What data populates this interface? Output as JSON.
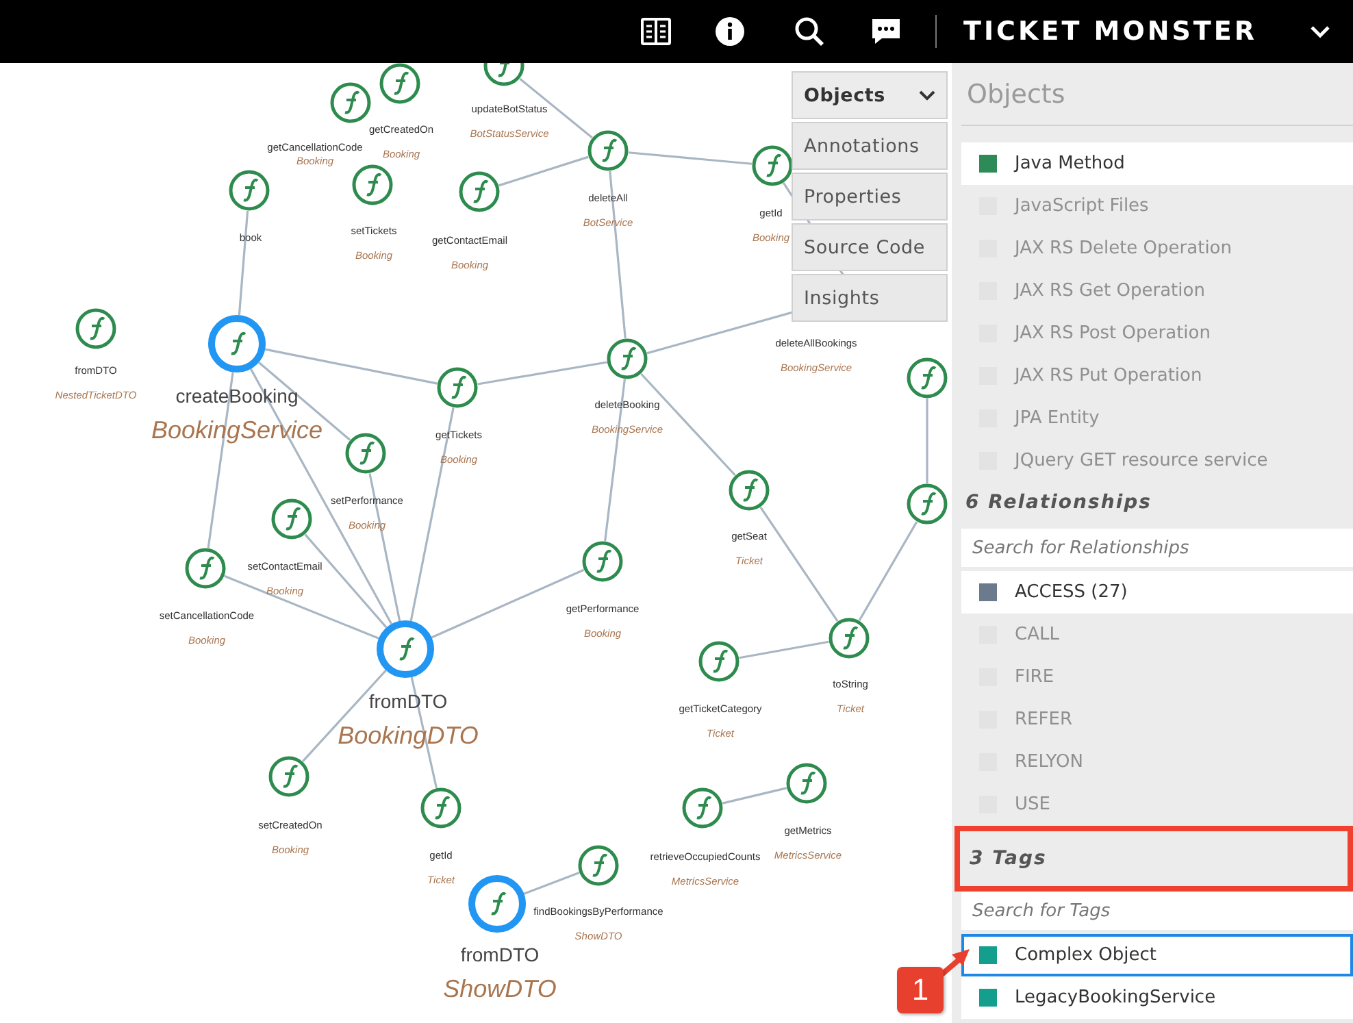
{
  "header": {
    "title": "TICKET MONSTER"
  },
  "graph": {
    "nodes": [
      {
        "method": "getCreatedOn",
        "class": "Booking",
        "highlighted": false
      },
      {
        "method": "getCancellationCode",
        "class": "Booking",
        "highlighted": false
      },
      {
        "method": "setTickets",
        "class": "Booking",
        "highlighted": false
      },
      {
        "method": "book",
        "highlighted": false
      },
      {
        "method": "getContactEmail",
        "class": "Booking",
        "highlighted": false
      },
      {
        "method": "updateBotStatus",
        "class": "BotStatusService",
        "highlighted": false
      },
      {
        "method": "deleteAll",
        "class": "BotService",
        "highlighted": false
      },
      {
        "method": "getId",
        "class": "Booking",
        "highlighted": false
      },
      {
        "method": "createBooking",
        "class": "BookingService",
        "highlighted": true
      },
      {
        "method": "fromDTO",
        "class": "NestedTicketDTO",
        "highlighted": false
      },
      {
        "method": "getTickets",
        "class": "Booking",
        "highlighted": false
      },
      {
        "method": "deleteBooking",
        "class": "BookingService",
        "highlighted": false
      },
      {
        "method": "deleteAllBookings",
        "class": "BookingService",
        "highlighted": false
      },
      {
        "highlighted": false
      },
      {
        "method": "setPerformance",
        "class": "Booking",
        "highlighted": false
      },
      {
        "method": "setContactEmail",
        "class": "Booking",
        "highlighted": false
      },
      {
        "method": "setCancellationCode",
        "class": "Booking",
        "highlighted": false
      },
      {
        "method": "getSeat",
        "class": "Ticket",
        "highlighted": false
      },
      {
        "highlighted": false
      },
      {
        "method": "getPerformance",
        "class": "Booking",
        "highlighted": false
      },
      {
        "method": "fromDTO",
        "class": "BookingDTO",
        "highlighted": true
      },
      {
        "method": "toString",
        "class": "Ticket",
        "highlighted": false
      },
      {
        "method": "getTicketCategory",
        "class": "Ticket",
        "highlighted": false
      },
      {
        "method": "setCreatedOn",
        "class": "Booking",
        "highlighted": false
      },
      {
        "method": "getId",
        "class": "Ticket",
        "highlighted": false
      },
      {
        "method": "getMetrics",
        "class": "MetricsService",
        "highlighted": false
      },
      {
        "method": "retrieveOccupiedCounts",
        "class": "MetricsService",
        "highlighted": false
      },
      {
        "method": "findBookingsByPerformance",
        "class": "ShowDTO",
        "highlighted": false
      },
      {
        "method": "fromDTO",
        "class": "ShowDTO",
        "highlighted": true
      }
    ]
  },
  "tabs": [
    {
      "label": "Objects",
      "selected": true
    },
    {
      "label": "Annotations",
      "selected": false
    },
    {
      "label": "Properties",
      "selected": false
    },
    {
      "label": "Source Code",
      "selected": false
    },
    {
      "label": "Insights",
      "selected": false
    }
  ],
  "objects": {
    "title": "Objects",
    "items": [
      {
        "label": "Java Method",
        "checked": true,
        "color": "#2e8b57"
      },
      {
        "label": "JavaScript Files",
        "checked": false
      },
      {
        "label": "JAX RS Delete Operation",
        "checked": false
      },
      {
        "label": "JAX RS Get Operation",
        "checked": false
      },
      {
        "label": "JAX RS Post Operation",
        "checked": false
      },
      {
        "label": "JAX RS Put Operation",
        "checked": false
      },
      {
        "label": "JPA Entity",
        "checked": false
      },
      {
        "label": "JQuery GET resource service",
        "checked": false
      }
    ]
  },
  "relationships": {
    "title": "6 Relationships",
    "search": {
      "placeholder": "Search for Relationships"
    },
    "items": [
      {
        "label": "ACCESS (27)",
        "checked": true,
        "color": "#6b7a8c"
      },
      {
        "label": "CALL",
        "checked": false
      },
      {
        "label": "FIRE",
        "checked": false
      },
      {
        "label": "REFER",
        "checked": false
      },
      {
        "label": "RELYON",
        "checked": false
      },
      {
        "label": "USE",
        "checked": false
      }
    ]
  },
  "tags": {
    "title": "3 Tags",
    "highlighted": true,
    "search": {
      "placeholder": "Search for Tags"
    },
    "items": [
      {
        "label": "Complex Object",
        "checked": true,
        "selected": true,
        "color": "#139e8e"
      },
      {
        "label": "LegacyBookingService",
        "checked": true,
        "selected": false,
        "color": "#139e8e"
      }
    ]
  },
  "callout": {
    "number": "1"
  }
}
